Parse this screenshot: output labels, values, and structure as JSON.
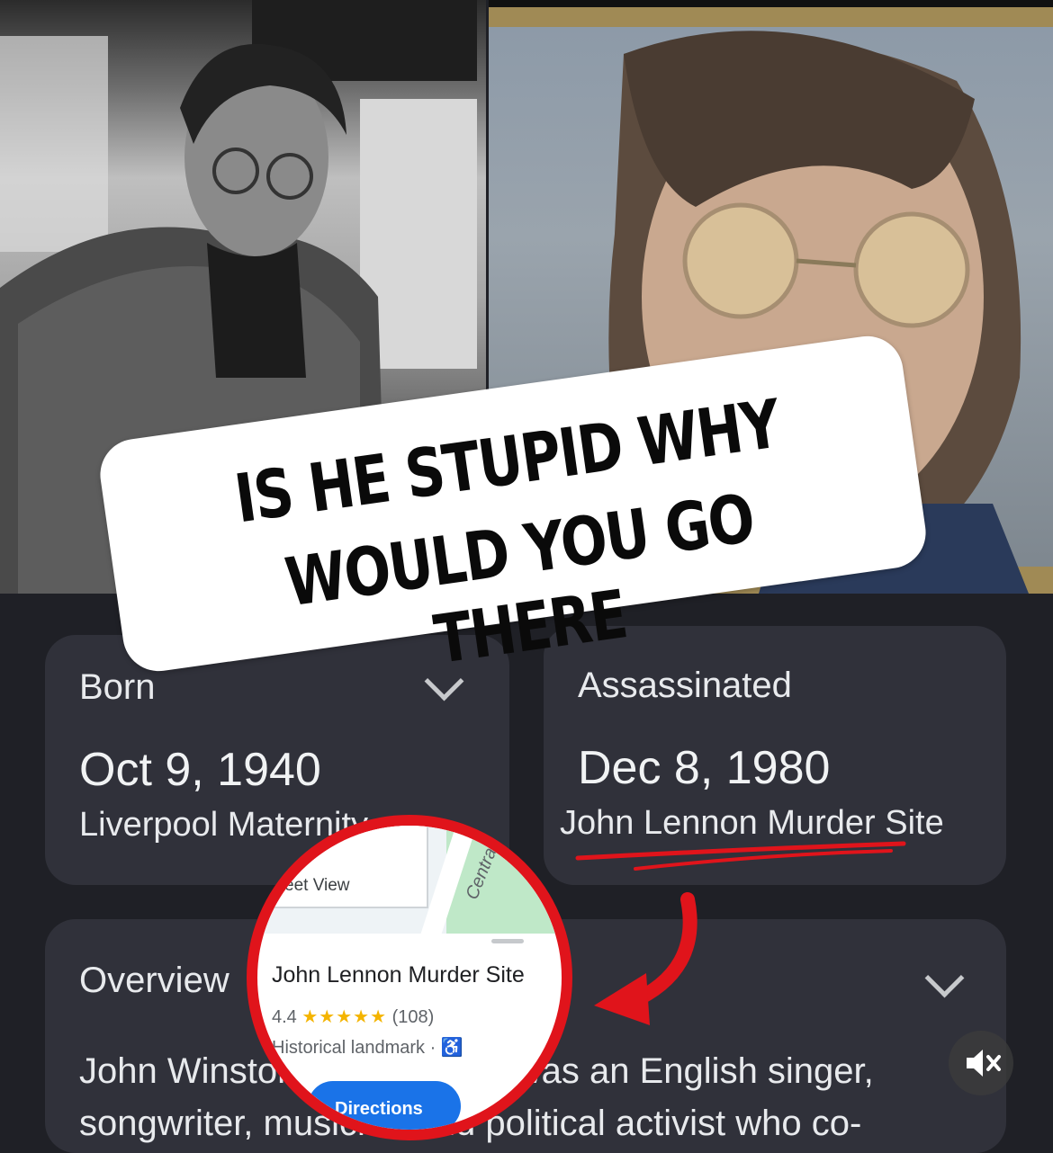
{
  "sticker": {
    "line1": "IS HE STUPID WHY",
    "line2": "WOULD YOU GO THERE"
  },
  "born_card": {
    "label": "Born",
    "date": "Oct 9, 1940",
    "place": "Liverpool Maternity"
  },
  "assassinated_card": {
    "label": "Assassinated",
    "date": "Dec 8, 1980",
    "place": "John Lennon Murder Site"
  },
  "overview_card": {
    "label": "Overview",
    "text": "John Winston Ono Lennon was an English singer, songwriter, musician and political activist who co-"
  },
  "map_popup": {
    "street_view_label": "eet View",
    "road_label": "Central",
    "place_title": "John Lennon Murder Site",
    "rating_value": "4.4",
    "stars": "★★★★★",
    "review_count": "(108)",
    "category": "Historical landmark ·",
    "directions_label": "Directions"
  },
  "icons": {
    "chevron": "chevron-down-icon",
    "mute": "speaker-muted-icon",
    "accessibility": "wheelchair-icon"
  },
  "colors": {
    "annotation_red": "#e0141b",
    "card_bg": "#30313a",
    "page_bg": "#1f2026",
    "accent_blue": "#1a73e8"
  }
}
